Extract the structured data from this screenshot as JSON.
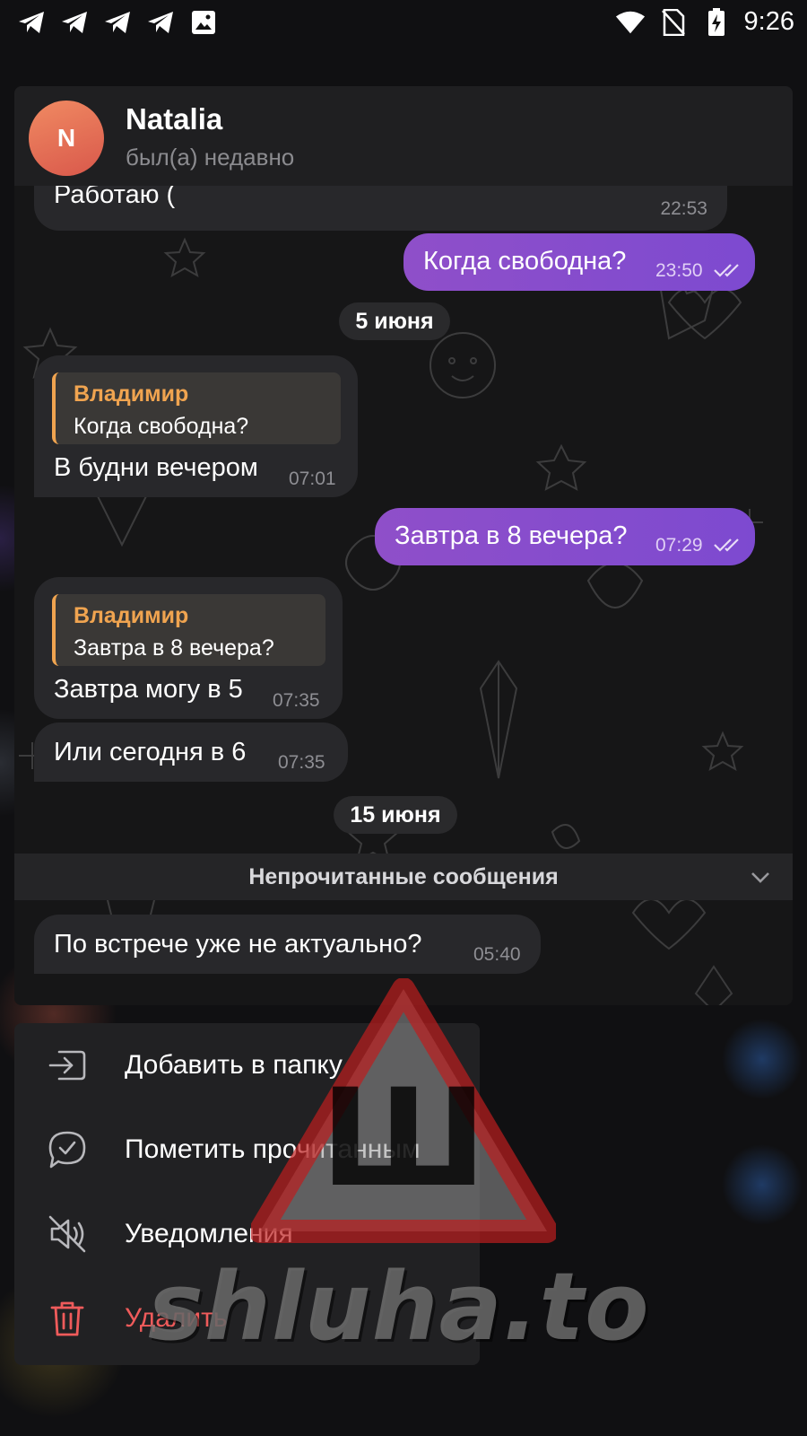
{
  "status_bar": {
    "time": "9:26",
    "left_icons": [
      "telegram-icon",
      "telegram-icon",
      "telegram-icon",
      "telegram-icon",
      "image-icon"
    ],
    "right_icons": [
      "wifi-icon",
      "no-sim-icon",
      "battery-charging-icon"
    ]
  },
  "chat": {
    "avatar_initial": "N",
    "name": "Natalia",
    "status": "был(а) недавно",
    "avatar_color": "#e56b55"
  },
  "messages": [
    {
      "id": "m1",
      "direction": "in",
      "text": "Работаю (",
      "time": "22:53"
    },
    {
      "id": "m2",
      "direction": "out",
      "text": "Когда свободна?",
      "time": "23:50",
      "read": true
    },
    {
      "id": "d1",
      "type": "date",
      "text": "5 июня"
    },
    {
      "id": "m3",
      "direction": "in",
      "reply_name": "Владимир",
      "reply_text": "Когда свободна?",
      "text": "В будни вечером",
      "time": "07:01"
    },
    {
      "id": "m4",
      "direction": "out",
      "text": "Завтра в 8 вечера?",
      "time": "07:29",
      "read": true
    },
    {
      "id": "m5",
      "direction": "in",
      "reply_name": "Владимир",
      "reply_text": "Завтра в 8 вечера?",
      "text": "Завтра могу в 5",
      "time": "07:35"
    },
    {
      "id": "m6",
      "direction": "in",
      "text": "Или сегодня в 6",
      "time": "07:35"
    },
    {
      "id": "d2",
      "type": "date",
      "text": "15 июня"
    },
    {
      "id": "m7",
      "direction": "in",
      "text": "По встрече уже не актуально?",
      "time": "05:40"
    }
  ],
  "unread_label": "Непрочитанные сообщения",
  "menu": {
    "add_to_folder": "Добавить в папку",
    "mark_read": "Пометить прочитанным",
    "notifications": "Уведомления",
    "delete": "Удалить"
  },
  "watermark": {
    "text": "shluha.to",
    "glyph": "Ш"
  },
  "colors": {
    "outgoing_bubble": "#8a4ecb",
    "incoming_bubble": "#28282b",
    "reply_accent": "#f0a450",
    "danger": "#ef5b5b"
  }
}
